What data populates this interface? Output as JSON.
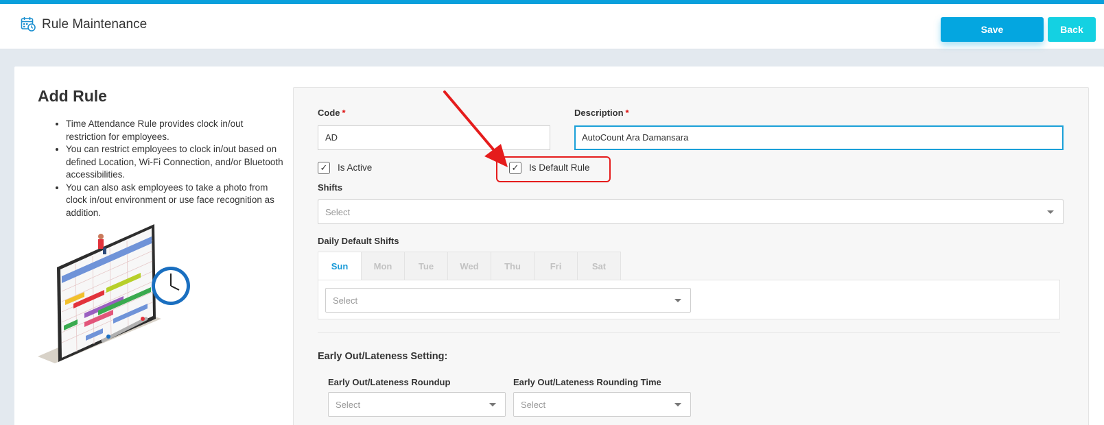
{
  "header": {
    "title": "Rule Maintenance",
    "save_label": "Save",
    "back_label": "Back"
  },
  "info": {
    "title": "Add Rule",
    "bullets": [
      "Time Attendance Rule provides clock in/out restriction for employees.",
      "You can restrict employees to clock in/out based on defined Location, Wi-Fi Connection, and/or Bluetooth accessibilities.",
      "You can also ask employees to take a photo from clock in/out environment or use face recognition as addition."
    ]
  },
  "form": {
    "code_label": "Code",
    "code_value": "AD",
    "description_label": "Description",
    "description_value": "AutoCount Ara Damansara",
    "required_mark": "*",
    "is_active_label": "Is Active",
    "is_active_checked": true,
    "is_default_label": "Is Default Rule",
    "is_default_checked": true,
    "check_glyph": "✓",
    "shifts_label": "Shifts",
    "shifts_placeholder": "Select",
    "daily_default_label": "Daily Default Shifts",
    "days": [
      "Sun",
      "Mon",
      "Tue",
      "Wed",
      "Thu",
      "Fri",
      "Sat"
    ],
    "active_day": "Sun",
    "daily_shift_placeholder": "Select",
    "section_title": "Early Out/Lateness Setting:",
    "roundup_label": "Early Out/Lateness Roundup",
    "roundup_placeholder": "Select",
    "rounding_time_label": "Early Out/Lateness Rounding Time",
    "rounding_time_placeholder": "Select"
  },
  "colors": {
    "accent": "#04a6e0",
    "back_button": "#14d1e2",
    "annotation_red": "#e51c1c"
  }
}
